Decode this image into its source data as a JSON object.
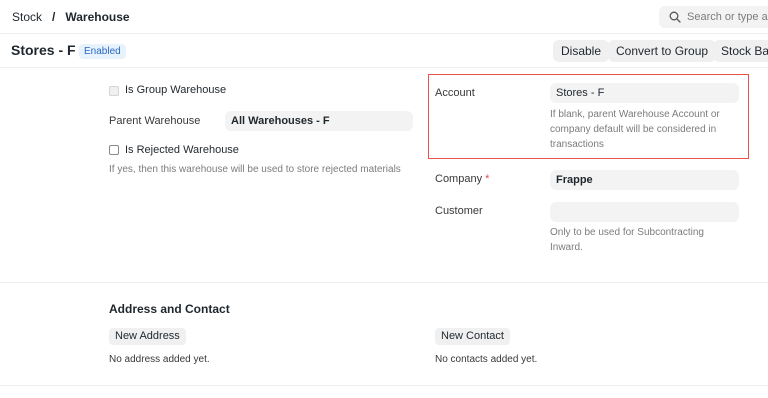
{
  "breadcrumb": {
    "parent": "Stock",
    "separator": "/",
    "current": "Warehouse"
  },
  "search": {
    "placeholder": "Search or type a c"
  },
  "page": {
    "title": "Stores - F",
    "status": "Enabled"
  },
  "actions": {
    "disable": "Disable",
    "convert_to_group": "Convert to Group",
    "stock_balance": "Stock Bala"
  },
  "form": {
    "is_group_warehouse": {
      "label": "Is Group Warehouse",
      "checked": false,
      "disabled": true
    },
    "parent_warehouse": {
      "label": "Parent Warehouse",
      "value": "All Warehouses - F"
    },
    "is_rejected_warehouse": {
      "label": "Is Rejected Warehouse",
      "checked": false,
      "help": "If yes, then this warehouse will be used to store rejected materials"
    },
    "account": {
      "label": "Account",
      "value": "Stores - F",
      "help_line1": "If blank, parent Warehouse Account or",
      "help_line2": "company default will be considered in",
      "help_line3": "transactions"
    },
    "company": {
      "label": "Company",
      "required_mark": "*",
      "value": "Frappe"
    },
    "customer": {
      "label": "Customer",
      "value": "",
      "help_line1": "Only to be used for Subcontracting",
      "help_line2": "Inward."
    }
  },
  "address_contact": {
    "title": "Address and Contact",
    "new_address": "New Address",
    "address_empty": "No address added yet.",
    "new_contact": "New Contact",
    "contact_empty": "No contacts added yet."
  },
  "colors": {
    "highlight": "#e9534a",
    "badge_text": "#2a69c4",
    "badge_bg": "#e8f2fd"
  }
}
